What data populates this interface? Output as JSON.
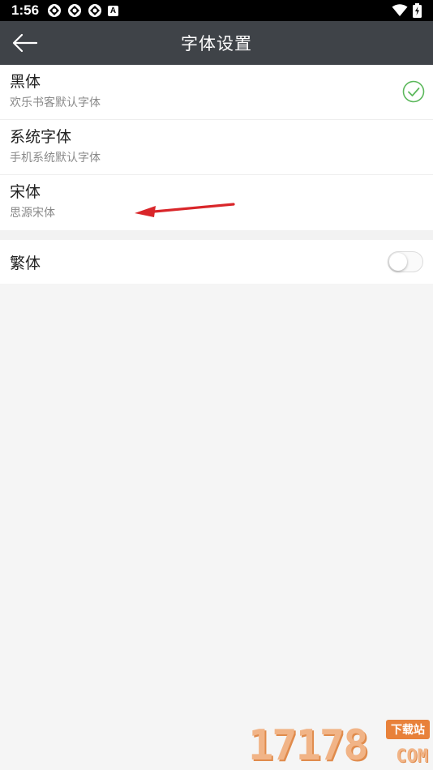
{
  "status_bar": {
    "time": "1:56",
    "notification_icons": [
      "app-notification-icon",
      "app-notification-icon",
      "app-notification-icon",
      "a-badge-icon"
    ],
    "a_badge": "A",
    "right_icons": [
      "wifi-icon",
      "battery-charging-icon"
    ]
  },
  "app_bar": {
    "title": "字体设置",
    "back_icon": "back-arrow-icon"
  },
  "fonts": [
    {
      "name": "黑体",
      "description": "欢乐书客默认字体",
      "selected": true
    },
    {
      "name": "系统字体",
      "description": "手机系统默认字体",
      "selected": false
    },
    {
      "name": "宋体",
      "description": "思源宋体",
      "selected": false
    }
  ],
  "traditional": {
    "label": "繁体",
    "enabled": false
  },
  "watermark": {
    "digits": "17178",
    "badge": "下载站",
    "suffix": "COM"
  },
  "colors": {
    "app_bar": "#3f4348",
    "check": "#5cb85c",
    "annotation_arrow": "#d9262a",
    "watermark": "#e8813a"
  }
}
